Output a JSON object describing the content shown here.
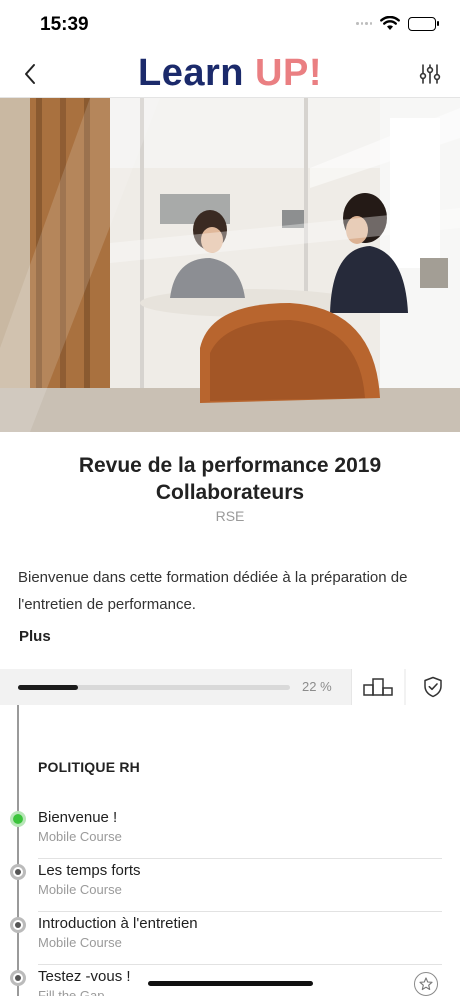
{
  "status_bar": {
    "time": "15:39"
  },
  "nav": {
    "logo_part1": "Learn",
    "logo_part2": "UP!",
    "back_icon": "chevron-left-icon",
    "filter_icon": "sliders-icon"
  },
  "hero": {
    "icon": "hero-photo"
  },
  "course": {
    "title": "Revue de la performance 2019 Collaborateurs",
    "category": "RSE",
    "description": "Bienvenue dans cette formation dédiée à la préparation de l'entretien de performance.",
    "more_label": "Plus"
  },
  "progress": {
    "percent": 0.22,
    "label": "22 %",
    "podium_icon": "podium-icon",
    "badge_icon": "shield-check-icon"
  },
  "section": {
    "title": "POLITIQUE RH"
  },
  "lessons": [
    {
      "title": "Bienvenue !",
      "type": "Mobile Course",
      "status": "active"
    },
    {
      "title": "Les temps forts",
      "type": "Mobile Course",
      "status": "pending"
    },
    {
      "title": "Introduction à l'entretien",
      "type": "Mobile Course",
      "status": "pending"
    },
    {
      "title": "Testez -vous !",
      "type": "Fill the Gap",
      "status": "pending",
      "icon": "star-icon"
    }
  ],
  "colors": {
    "logo_navy": "#1b2a6b",
    "logo_pink": "#ea7f82",
    "active_green": "#3bc43b",
    "progress_fill": "#1c1c1c"
  }
}
